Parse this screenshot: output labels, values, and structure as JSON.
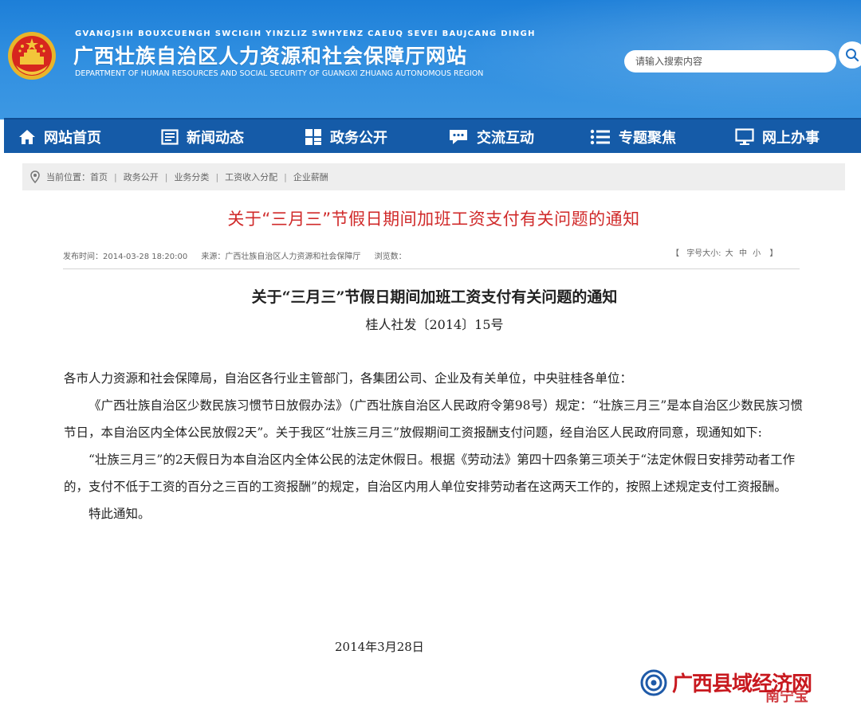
{
  "header": {
    "pinyin": "GVANGJSIH BOUXCUENGH SWCIGIH YINZLIZ SWHYENZ CAEUQ SEVEI BAUJCANG DINGH",
    "title": "广西壮族自治区人力资源和社会保障厅网站",
    "english": "DEPARTMENT OF HUMAN RESOURCES AND SOCIAL SECURITY OF GUANGXI ZHUANG AUTONOMOUS REGION",
    "search_placeholder": "请输入搜索内容",
    "brand_color": "#2a89dd"
  },
  "nav": {
    "items": [
      {
        "label": "网站首页",
        "icon": "home-icon"
      },
      {
        "label": "新闻动态",
        "icon": "news-icon"
      },
      {
        "label": "政务公开",
        "icon": "grid-icon"
      },
      {
        "label": "交流互动",
        "icon": "chat-icon"
      },
      {
        "label": "专题聚焦",
        "icon": "list-icon"
      },
      {
        "label": "网上办事",
        "icon": "monitor-icon"
      }
    ],
    "color": "#155ba8"
  },
  "breadcrumb": {
    "label": "当前位置：",
    "items": [
      "首页",
      "政务公开",
      "业务分类",
      "工资收入分配",
      "企业薪酬"
    ]
  },
  "article": {
    "title": "关于“三月三”节假日期间加班工资支付有关问题的通知",
    "publish_time": "发布时间：2014-03-28 18:20:00",
    "source": "来源：广西壮族自治区人力资源和社会保障厅",
    "views": "浏览数：",
    "font_size_label": "字号大小:",
    "font_size_options": [
      "大",
      "中",
      "小"
    ],
    "bracket_open": "【",
    "bracket_close": "】"
  },
  "document": {
    "title": "关于“三月三”节假日期间加班工资支付有关问题的通知",
    "number": "桂人社发〔2014〕15号",
    "addressee": "各市人力资源和社会保障局，自治区各行业主管部门，各集团公司、企业及有关单位，中央驻桂各单位：",
    "para1": "《广西壮族自治区少数民族习惯节日放假办法》（广西壮族自治区人民政府令第98号）规定：“壮族三月三”是本自治区少数民族习惯节日，本自治区内全体公民放假2天”。关于我区“壮族三月三”放假期间工资报酬支付问题，经自治区人民政府同意，现通知如下:",
    "para2": "“壮族三月三”的2天假日为本自治区内全体公民的法定休假日。根据《劳动法》第四十四条第三项关于“法定休假日安排劳动者工作的，支付不低于工资的百分之三百的工资报酬”的规定，自治区内用人单位安排劳动者在这两天工作的，按照上述规定支付工资报酬。",
    "para3": "特此通知。",
    "date": "2014年3月28日"
  },
  "watermark": {
    "text": "广西县域经济网",
    "sub": "南宁宝"
  }
}
